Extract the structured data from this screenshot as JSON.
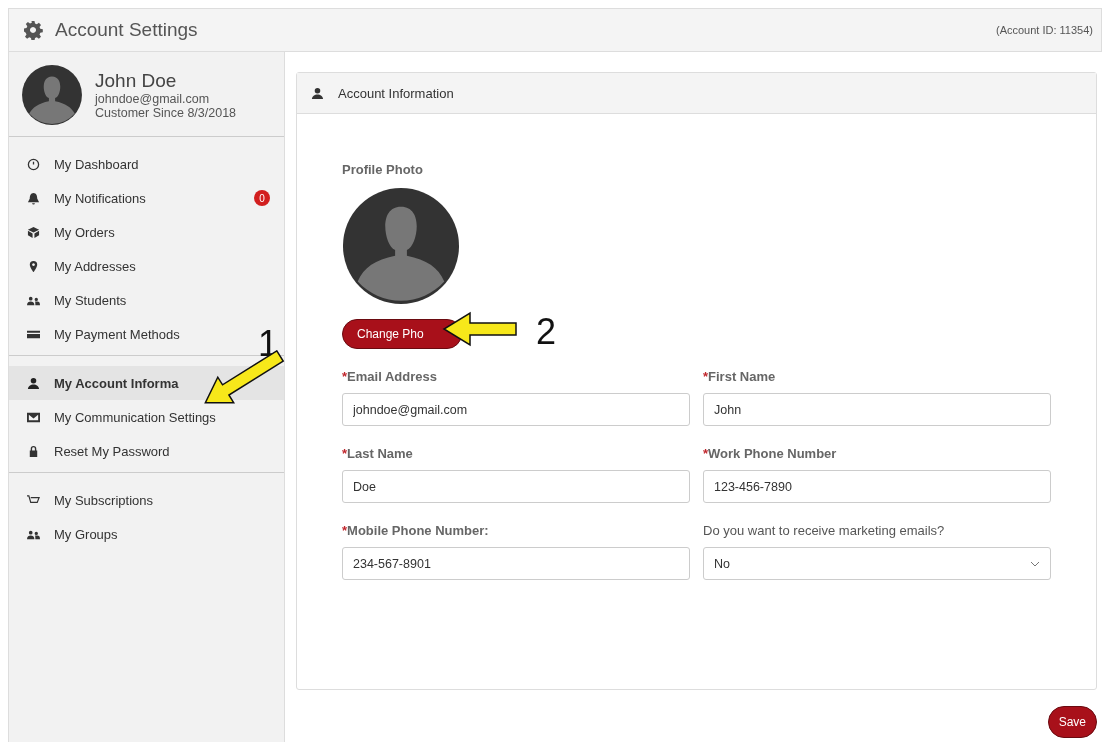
{
  "header": {
    "title": "Account Settings",
    "account_id": "(Account ID: 11354)"
  },
  "profile": {
    "name": "John Doe",
    "email": "johndoe@gmail.com",
    "since": "Customer Since 8/3/2018"
  },
  "menu_groups": [
    {
      "items": [
        {
          "label": "My Dashboard",
          "selected": false
        },
        {
          "label": "My Notifications",
          "selected": false,
          "badge": "0"
        },
        {
          "label": "My Orders",
          "selected": false
        },
        {
          "label": "My Addresses",
          "selected": false
        },
        {
          "label": "My Students",
          "selected": false
        },
        {
          "label": "My Payment Methods",
          "selected": false
        }
      ]
    },
    {
      "items": [
        {
          "label": "My Account Informa",
          "selected": true
        },
        {
          "label": "My Communication Settings",
          "selected": false
        },
        {
          "label": "Reset My Password",
          "selected": false
        }
      ]
    },
    {
      "items": [
        {
          "label": "My Subscriptions",
          "selected": false
        },
        {
          "label": "My Groups",
          "selected": false
        }
      ]
    }
  ],
  "panel": {
    "title": "Account Information",
    "photo_label": "Profile Photo",
    "change_photo": "Change Pho",
    "fields": [
      {
        "kind": "text",
        "required_mark": "*",
        "label": "Email Address",
        "value": "johndoe@gmail.com"
      },
      {
        "kind": "text",
        "required_mark": "*",
        "label": "First Name",
        "value": "John"
      },
      {
        "kind": "text",
        "required_mark": "*",
        "label": "Last Name",
        "value": "Doe"
      },
      {
        "kind": "text",
        "required_mark": "*",
        "label": "Work Phone Number",
        "value": "123-456-7890"
      },
      {
        "kind": "text",
        "required_mark": "*",
        "label": "Mobile Phone Number:",
        "value": "234-567-8901"
      },
      {
        "kind": "select",
        "label": "Do you want to receive marketing emails?",
        "value": "No"
      }
    ]
  },
  "save": "Save",
  "annotations": [
    {
      "label": "1"
    },
    {
      "label": "2"
    }
  ]
}
